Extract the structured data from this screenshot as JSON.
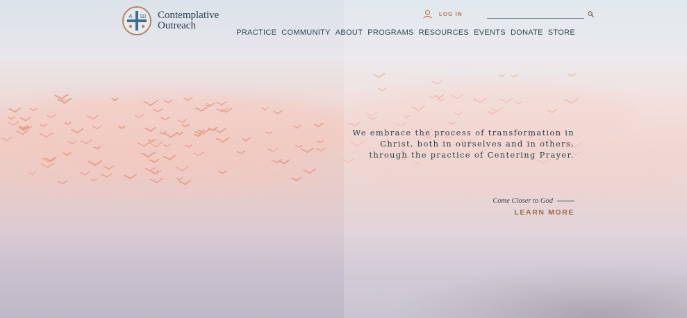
{
  "brand": {
    "name_line1": "Contemplative",
    "name_line2": "Outreach",
    "mark_letters": [
      "А",
      "Ш"
    ]
  },
  "header": {
    "login_label": "LOG IN",
    "search_placeholder": ""
  },
  "nav": [
    "PRACTICE",
    "COMMUNITY",
    "ABOUT",
    "PROGRAMS",
    "RESOURCES",
    "EVENTS",
    "DONATE",
    "STORE"
  ],
  "hero": {
    "mission_lines": [
      "We embrace the process of transformation in",
      "Christ, both in ourselves and in others,",
      "through the practice of Centering Prayer."
    ],
    "cta_tagline": "Come Closer to God",
    "cta_button": "LEARN MORE"
  },
  "colors": {
    "accent": "#b07a55",
    "text": "#2f3d48",
    "bird": "#e7a595"
  }
}
